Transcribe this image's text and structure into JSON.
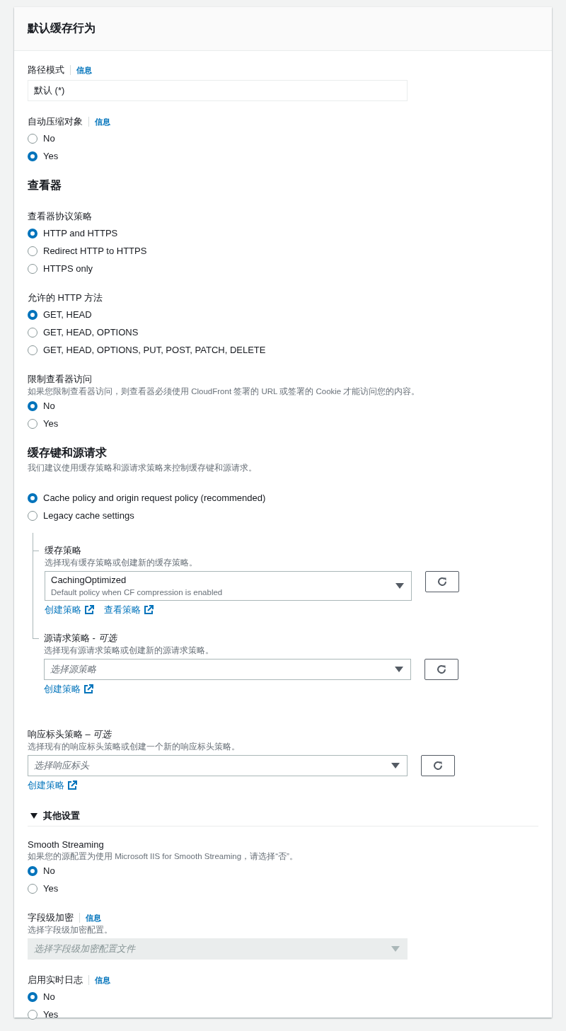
{
  "panel": {
    "title": "默认缓存行为"
  },
  "blocks": [
    {
      "kind": "text_field",
      "label": "路径模式",
      "info": "信息",
      "value": "默认 (*)"
    },
    {
      "kind": "radio_group",
      "label": "自动压缩对象",
      "info": "信息",
      "options": [
        {
          "label": "No",
          "selected": false
        },
        {
          "label": "Yes",
          "selected": true
        }
      ]
    },
    {
      "kind": "heading",
      "text": "查看器"
    },
    {
      "kind": "radio_group",
      "label": "查看器协议策略",
      "options": [
        {
          "label": "HTTP and HTTPS",
          "selected": true
        },
        {
          "label": "Redirect HTTP to HTTPS",
          "selected": false
        },
        {
          "label": "HTTPS only",
          "selected": false
        }
      ]
    },
    {
      "kind": "radio_group",
      "label": "允许的 HTTP 方法",
      "options": [
        {
          "label": "GET, HEAD",
          "selected": true
        },
        {
          "label": "GET, HEAD, OPTIONS",
          "selected": false
        },
        {
          "label": "GET, HEAD, OPTIONS, PUT, POST, PATCH, DELETE",
          "selected": false
        }
      ]
    },
    {
      "kind": "radio_group",
      "label": "限制查看器访问",
      "description": "如果您限制查看器访问，则查看器必须使用 CloudFront 签署的 URL 或签署的 Cookie 才能访问您的内容。",
      "options": [
        {
          "label": "No",
          "selected": true
        },
        {
          "label": "Yes",
          "selected": false
        }
      ]
    },
    {
      "kind": "heading",
      "text": "缓存键和源请求",
      "description": "我们建议使用缓存策略和源请求策略来控制缓存键和源请求。"
    },
    {
      "kind": "radio_group",
      "options": [
        {
          "label": "Cache policy and origin request policy (recommended)",
          "selected": true
        },
        {
          "label": "Legacy cache settings",
          "selected": false
        }
      ]
    },
    {
      "kind": "tree",
      "items": [
        {
          "label": "缓存策略",
          "description": "选择现有缓存策略或创建新的缓存策略。",
          "select": {
            "value": "CachingOptimized",
            "subtext": "Default policy when CF compression is enabled"
          },
          "links": [
            "创建策略",
            "查看策略"
          ]
        },
        {
          "label": "源请求策略 - *可选*",
          "description": "选择现有源请求策略或创建新的源请求策略。",
          "select": {
            "placeholder": "选择源策略"
          },
          "links": [
            "创建策略"
          ]
        }
      ]
    },
    {
      "kind": "select_field",
      "label": "响应标头策略 – *可选*",
      "description": "选择现有的响应标头策略或创建一个新的响应标头策略。",
      "select": {
        "placeholder": "选择响应标头"
      },
      "refresh": true,
      "links": [
        "创建策略"
      ]
    },
    {
      "kind": "expander",
      "text": "其他设置",
      "expanded": true
    },
    {
      "kind": "radio_group",
      "label": "Smooth Streaming",
      "description": "如果您的源配置为使用 Microsoft IIS for Smooth Streaming，请选择“否”。",
      "options": [
        {
          "label": "No",
          "selected": true
        },
        {
          "label": "Yes",
          "selected": false
        }
      ]
    },
    {
      "kind": "select_field",
      "label": "字段级加密",
      "info": "信息",
      "description": "选择字段级加密配置。",
      "select": {
        "placeholder": "选择字段级加密配置文件",
        "disabled": true
      },
      "refresh": false
    },
    {
      "kind": "radio_group",
      "label": "启用实时日志",
      "info": "信息",
      "options": [
        {
          "label": "No",
          "selected": true
        },
        {
          "label": "Yes",
          "selected": false
        }
      ]
    }
  ]
}
